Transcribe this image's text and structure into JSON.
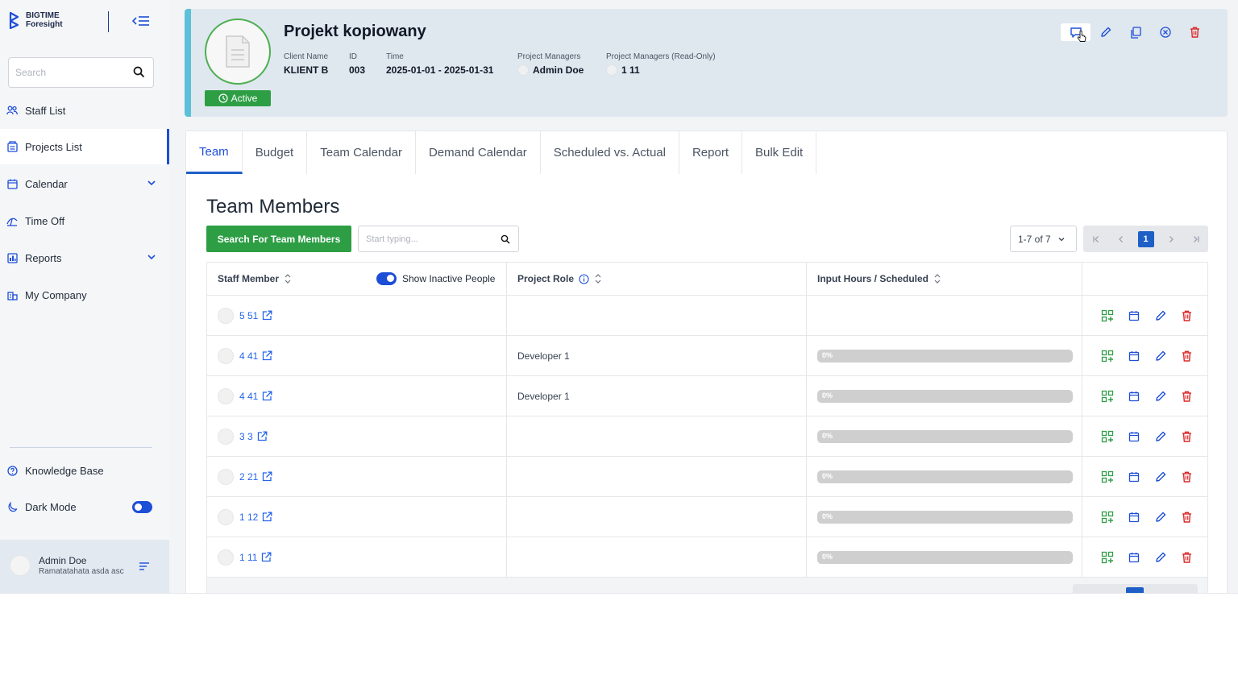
{
  "brand": {
    "line1": "BIGTIME",
    "line2": "Foresight"
  },
  "sidebar": {
    "search_placeholder": "Search",
    "items": [
      {
        "label": "Staff List",
        "icon": "staff-icon"
      },
      {
        "label": "Projects List",
        "icon": "projects-icon",
        "active": true
      },
      {
        "label": "Calendar",
        "icon": "calendar-icon",
        "expandable": true
      },
      {
        "label": "Time Off",
        "icon": "time-off-icon"
      },
      {
        "label": "Reports",
        "icon": "reports-icon",
        "expandable": true
      },
      {
        "label": "My Company",
        "icon": "company-icon"
      }
    ],
    "knowledge_base": "Knowledge Base",
    "dark_mode": "Dark Mode",
    "user": {
      "name": "Admin Doe",
      "subtitle": "Ramatatahata asda asc"
    }
  },
  "project": {
    "title": "Projekt kopiowany",
    "status": "Active",
    "client_label": "Client Name",
    "client": "KLIENT B",
    "id_label": "ID",
    "id": "003",
    "time_label": "Time",
    "time": "2025-01-01 - 2025-01-31",
    "pm_label": "Project Managers",
    "pm": "Admin Doe",
    "pm_ro_label": "Project Managers (Read-Only)",
    "pm_ro": "1 11"
  },
  "tabs": [
    "Team",
    "Budget",
    "Team Calendar",
    "Demand Calendar",
    "Scheduled vs. Actual",
    "Report",
    "Bulk Edit"
  ],
  "team": {
    "title": "Team Members",
    "search_button": "Search For Team Members",
    "search_placeholder": "Start typing...",
    "page_size": "1-7 of 7",
    "current_page": "1",
    "columns": {
      "staff": "Staff Member",
      "show_inactive": "Show Inactive People",
      "role": "Project Role",
      "hours": "Input Hours / Scheduled"
    },
    "rows": [
      {
        "name": "5 51",
        "role": "",
        "progress": null
      },
      {
        "name": "4 41",
        "role": "Developer 1",
        "progress": "0%"
      },
      {
        "name": "4 41",
        "role": "Developer 1",
        "progress": "0%"
      },
      {
        "name": "3 3",
        "role": "",
        "progress": "0%"
      },
      {
        "name": "2 21",
        "role": "",
        "progress": "0%"
      },
      {
        "name": "1 12",
        "role": "",
        "progress": "0%"
      },
      {
        "name": "1 11",
        "role": "",
        "progress": "0%"
      }
    ]
  },
  "colors": {
    "accent": "#1d5fc7",
    "green": "#2e9e45",
    "danger": "#dc2626",
    "header_bg": "#dfe7ef"
  }
}
